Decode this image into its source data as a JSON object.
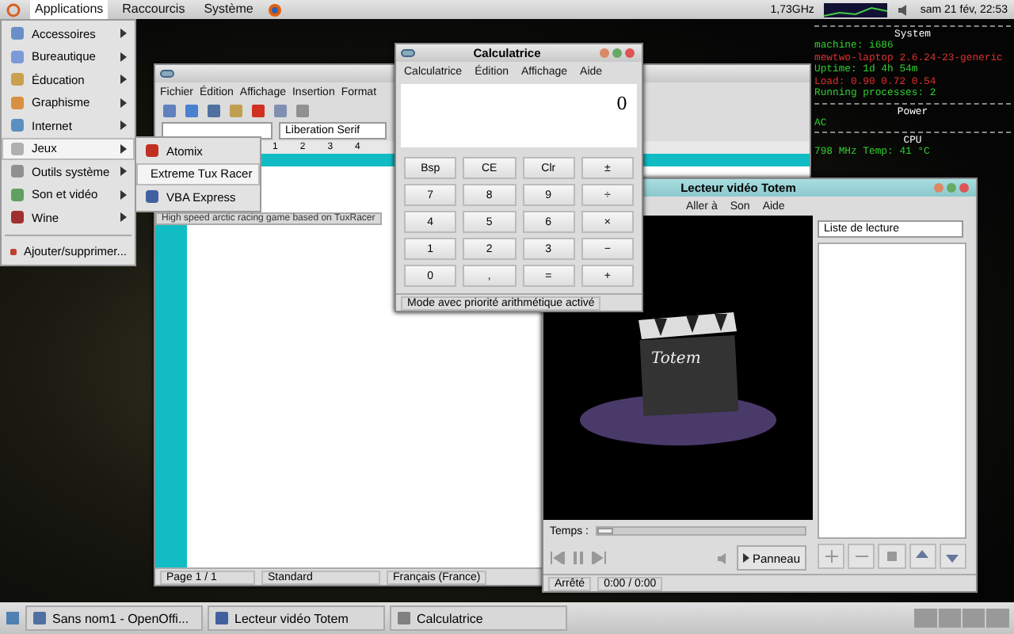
{
  "top_panel": {
    "menus": [
      "Applications",
      "Raccourcis",
      "Système"
    ],
    "cpu_freq": "1,73GHz",
    "clock": "sam 21 fév, 22:53"
  },
  "app_menu": {
    "items": [
      {
        "label": "Accessoires",
        "selected": false
      },
      {
        "label": "Bureautique",
        "selected": false
      },
      {
        "label": "Éducation",
        "selected": false
      },
      {
        "label": "Graphisme",
        "selected": false
      },
      {
        "label": "Internet",
        "selected": false
      },
      {
        "label": "Jeux",
        "selected": true
      },
      {
        "label": "Outils système",
        "selected": false
      },
      {
        "label": "Son et vidéo",
        "selected": false
      },
      {
        "label": "Wine",
        "selected": false
      }
    ],
    "action": "Ajouter/supprimer...",
    "submenu": [
      {
        "label": "Atomix",
        "selected": false
      },
      {
        "label": "Extreme Tux Racer",
        "selected": true
      },
      {
        "label": "VBA Express",
        "selected": false
      }
    ],
    "tooltip": "High speed arctic racing game based on TuxRacer"
  },
  "writer": {
    "menu": [
      "Fichier",
      "Édition",
      "Affichage",
      "Insertion",
      "Format"
    ],
    "font": "Liberation Serif",
    "ruler": [
      "1",
      "2",
      "3",
      "4"
    ],
    "status": [
      "Page 1 / 1",
      "Standard",
      "Français (France)"
    ]
  },
  "calculator": {
    "title": "Calculatrice",
    "menu": [
      "Calculatrice",
      "Édition",
      "Affichage",
      "Aide"
    ],
    "display": "0",
    "keys": [
      "Bsp",
      "CE",
      "Clr",
      "±",
      "7",
      "8",
      "9",
      "÷",
      "4",
      "5",
      "6",
      "×",
      "1",
      "2",
      "3",
      "−",
      "0",
      ",",
      "=",
      "+"
    ],
    "status": "Mode avec priorité arithmétique activé"
  },
  "totem": {
    "title": "Lecteur vidéo Totem",
    "menu": [
      "Aller à",
      "Son",
      "Aide"
    ],
    "logo_text": "Totem",
    "seek": {
      "level": 0.08
    },
    "playlist": "Liste de lecture",
    "time_label": "Temps :",
    "panel_button": "Panneau",
    "state": "Arrêté",
    "time": "0:00 / 0:00"
  },
  "conky": {
    "sections": [
      {
        "title": "System",
        "lines": [
          "machine: i686",
          "mewtwo-laptop 2.6.24-23-generic",
          "Uptime: 1d 4h 54m",
          "Load: 0.90 0.72 0.54",
          "Running processes: 2"
        ]
      },
      {
        "title": "Power",
        "lines": [
          "AC"
        ]
      },
      {
        "title": "CPU",
        "lines": [
          "798 MHz  Temp: 41 °C"
        ]
      }
    ]
  },
  "taskbar": [
    "Sans nom1 - OpenOffi...",
    "Lecteur vidéo Totem",
    "Calculatrice"
  ]
}
